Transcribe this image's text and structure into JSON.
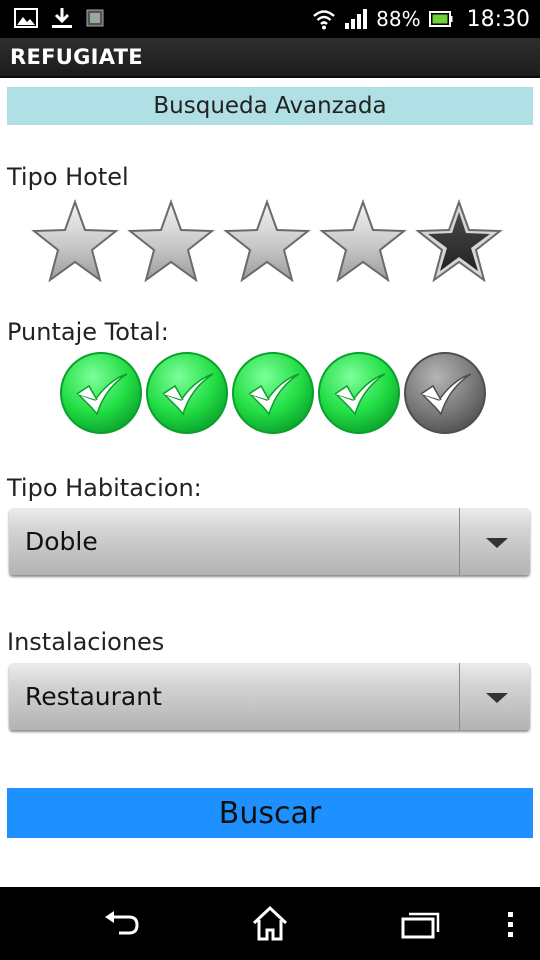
{
  "status_bar": {
    "battery_percent": "88%",
    "time": "18:30",
    "icons": [
      "gallery-icon",
      "download-icon",
      "app-notification-icon",
      "wifi-icon",
      "signal-icon",
      "battery-icon"
    ]
  },
  "action_bar": {
    "title": "REFUGIATE"
  },
  "page": {
    "heading": "Busqueda Avanzada",
    "hotel_type": {
      "label": "Tipo Hotel",
      "selected_stars": 4,
      "max_stars": 5
    },
    "total_score": {
      "label": "Puntaje Total:",
      "selected": 4,
      "max": 5
    },
    "room_type": {
      "label": "Tipo Habitacion:",
      "value": "Doble"
    },
    "facilities": {
      "label": "Instalaciones",
      "value": "Restaurant"
    },
    "search_button": "Buscar"
  },
  "colors": {
    "banner": "#b0e0e6",
    "search_button": "#1e90ff",
    "check_active": "#22dd44",
    "check_inactive": "#7a7a7a"
  },
  "nav_bar": {
    "buttons": [
      "back-icon",
      "home-icon",
      "recent-apps-icon",
      "overflow-menu-icon"
    ]
  }
}
